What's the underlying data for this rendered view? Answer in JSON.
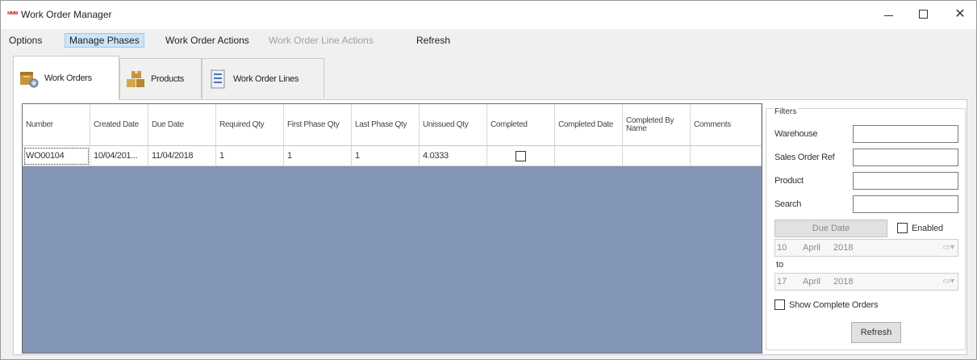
{
  "window": {
    "title": "Work Order Manager",
    "icon_text": "ᴍᴍᴍ",
    "minimize": "minimize-icon",
    "maximize": "maximize-icon",
    "close_glyph": "✕"
  },
  "menu": {
    "items": [
      {
        "label": "Options",
        "state": "normal"
      },
      {
        "label": "Manage Phases",
        "state": "active"
      },
      {
        "label": "Work Order Actions",
        "state": "normal"
      },
      {
        "label": "Work Order Line Actions",
        "state": "disabled"
      },
      {
        "label": "Refresh",
        "state": "normal"
      }
    ]
  },
  "tabs": [
    {
      "label": "Work Orders",
      "icon": "work-orders-icon",
      "selected": true
    },
    {
      "label": "Products",
      "icon": "products-icon",
      "selected": false
    },
    {
      "label": "Work Order Lines",
      "icon": "work-order-lines-icon",
      "selected": false
    }
  ],
  "grid": {
    "columns": [
      "Number",
      "Created Date",
      "Due Date",
      "Required Qty",
      "First Phase Qty",
      "Last Phase Qty",
      "Unissued Qty",
      "Completed",
      "Completed Date",
      "Completed By Name",
      "Comments"
    ],
    "rows": [
      {
        "number": "WO00104",
        "created_date": "10/04/201...",
        "due_date": "11/04/2018",
        "required_qty": "1",
        "first_phase_qty": "1",
        "last_phase_qty": "1",
        "unissued_qty": "4.0333",
        "completed": false,
        "completed_date": "",
        "completed_by_name": "",
        "comments": ""
      }
    ]
  },
  "filters": {
    "title": "Filters",
    "warehouse_label": "Warehouse",
    "warehouse_value": "",
    "sales_order_ref_label": "Sales Order Ref",
    "sales_order_ref_value": "",
    "product_label": "Product",
    "product_value": "",
    "search_label": "Search",
    "search_value": "",
    "due_date_label": "Due Date",
    "enabled_label": "Enabled",
    "enabled_checked": false,
    "from_day": "10",
    "from_month": "April",
    "from_year": "2018",
    "to_label": "to",
    "to_day": "17",
    "to_month": "April",
    "to_year": "2018",
    "show_complete_label": "Show Complete Orders",
    "show_complete_checked": false,
    "refresh_label": "Refresh"
  },
  "colors": {
    "grid_background": "#8395b4",
    "menu_active": "#cce4f7"
  }
}
